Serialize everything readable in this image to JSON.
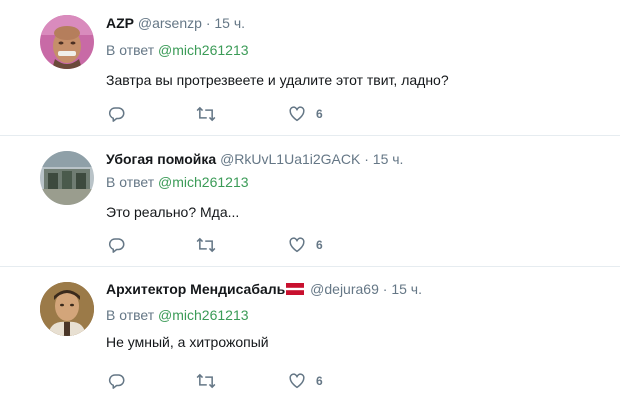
{
  "tweets": [
    {
      "name": "AZP",
      "handle": "@arsenzp",
      "time": "15 ч.",
      "reply_prefix": "В ответ",
      "reply_to": "@mich261213",
      "text": "Завтра вы протрезвеете и удалите этот твит, ладно?",
      "likes": "6"
    },
    {
      "name": "Убогая помойка",
      "handle": "@RkUvL1Ua1i2GACK",
      "time": "15 ч.",
      "reply_prefix": "В ответ",
      "reply_to": "@mich261213",
      "text": "Это реально? Мда...",
      "likes": "6"
    },
    {
      "name": "Архитектор Мендисабаль",
      "handle": "@dejura69",
      "time": "15 ч.",
      "reply_prefix": "В ответ",
      "reply_to": "@mich261213",
      "text": "Не умный, а хитрожопый",
      "likes": "6"
    }
  ],
  "separator": "·",
  "colors": {
    "secondary_text": "#657786",
    "mention": "#3b9b57",
    "divider": "#e6ecf0",
    "flag_red": "#c8102e"
  }
}
